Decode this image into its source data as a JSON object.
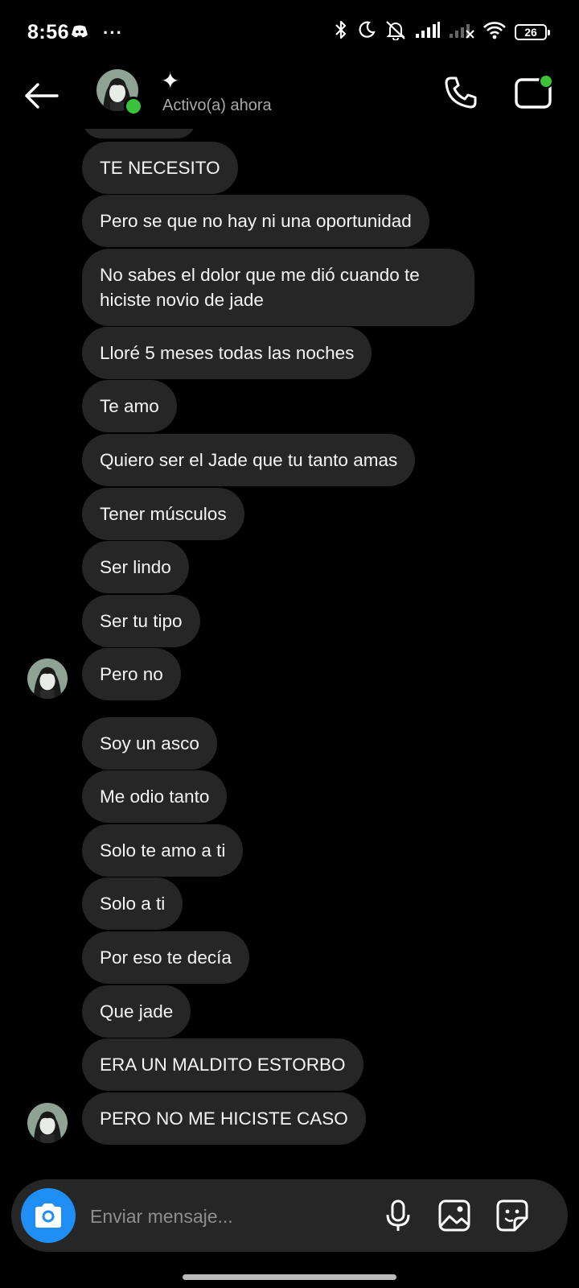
{
  "status_bar": {
    "time": "8:56",
    "overflow_glyph": "···",
    "battery_level": "26",
    "icons": [
      "discord-icon",
      "bluetooth-icon",
      "moon-icon",
      "silent-icon",
      "signal-icon",
      "no-signal-icon",
      "wifi-icon",
      "battery-icon"
    ]
  },
  "header": {
    "contact_name": "✦",
    "presence": "Activo(a) ahora",
    "online": true,
    "icons": [
      "back-arrow-icon",
      "phone-icon",
      "video-camera-icon"
    ]
  },
  "messages": [
    {
      "text": "TE NECESITO",
      "avatar": false
    },
    {
      "text": "Pero se que no hay ni una oportunidad",
      "avatar": false
    },
    {
      "text": "No sabes el dolor que me dió cuando te hiciste novio de jade",
      "avatar": false
    },
    {
      "text": "Lloré 5 meses todas las noches",
      "avatar": false
    },
    {
      "text": "Te amo",
      "avatar": false
    },
    {
      "text": "Quiero ser el Jade que tu tanto amas",
      "avatar": false
    },
    {
      "text": "Tener músculos",
      "avatar": false
    },
    {
      "text": "Ser lindo",
      "avatar": false
    },
    {
      "text": "Ser tu tipo",
      "avatar": false
    },
    {
      "text": "Pero no",
      "avatar": true
    },
    {
      "text": "Soy un asco",
      "avatar": false
    },
    {
      "text": "Me odio tanto",
      "avatar": false
    },
    {
      "text": "Solo te amo a ti",
      "avatar": false
    },
    {
      "text": "Solo a ti",
      "avatar": false
    },
    {
      "text": "Por eso te decía",
      "avatar": false
    },
    {
      "text": "Que jade",
      "avatar": false
    },
    {
      "text": "ERA UN MALDITO ESTORBO",
      "avatar": false
    },
    {
      "text": "PERO NO ME HICISTE CASO",
      "avatar": true
    }
  ],
  "composer": {
    "placeholder": "Enviar mensaje...",
    "icons": [
      "camera-icon",
      "microphone-icon",
      "image-icon",
      "sticker-icon"
    ]
  },
  "colors": {
    "background": "#000000",
    "bubble": "#262626",
    "accent_blue": "#1f8ff5",
    "online_green": "#3ac23a",
    "secondary_text": "#a8a8a8"
  }
}
